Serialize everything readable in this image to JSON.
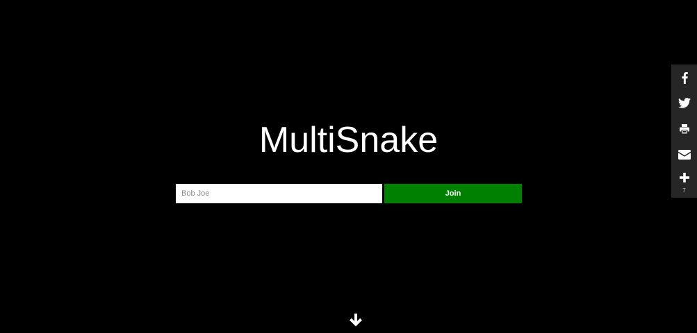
{
  "app": {
    "title": "MultiSnake"
  },
  "join_form": {
    "name_placeholder": "Bob Joe",
    "name_value": "",
    "join_label": "Join"
  },
  "share_bar": {
    "items": [
      {
        "icon": "facebook-icon"
      },
      {
        "icon": "twitter-icon"
      },
      {
        "icon": "print-icon"
      },
      {
        "icon": "email-icon"
      },
      {
        "icon": "plus-icon"
      }
    ],
    "share_count": "7"
  },
  "scroll": {
    "icon": "arrow-down-icon"
  },
  "colors": {
    "background": "#000000",
    "join_button": "#008000",
    "share_bar": "#262626",
    "text": "#ffffff"
  }
}
